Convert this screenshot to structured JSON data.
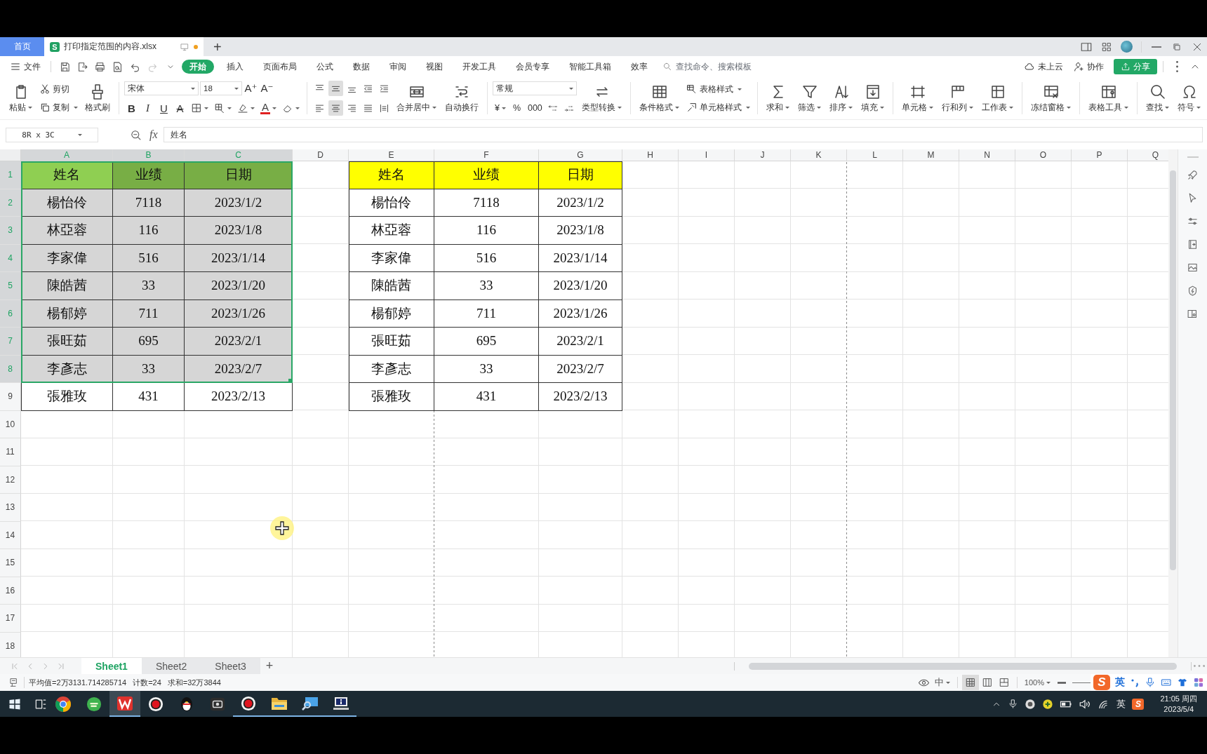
{
  "tab_bar": {
    "home_tab": "首页",
    "document_tab": {
      "app_badge": "S",
      "title": "打印指定范围的内容.xlsx",
      "unsaved": true
    },
    "new_tab": "+"
  },
  "menu_bar": {
    "file": "文件",
    "tabs": [
      {
        "label": "开始",
        "selected": true
      },
      {
        "label": "插入",
        "selected": false
      },
      {
        "label": "页面布局",
        "selected": false
      },
      {
        "label": "公式",
        "selected": false
      },
      {
        "label": "数据",
        "selected": false
      },
      {
        "label": "审阅",
        "selected": false
      },
      {
        "label": "视图",
        "selected": false
      },
      {
        "label": "开发工具",
        "selected": false
      },
      {
        "label": "会员专享",
        "selected": false
      },
      {
        "label": "智能工具箱",
        "selected": false
      },
      {
        "label": "效率",
        "selected": false
      }
    ],
    "search": {
      "placeholder": "查找命令、搜索模板"
    },
    "cloud_status": "未上云",
    "collaborate": "协作",
    "share": "分享"
  },
  "ribbon": {
    "paste": {
      "label": "粘贴",
      "dropdown": true
    },
    "cut": {
      "label": "剪切",
      "dropdown": false
    },
    "copy": {
      "label": "复制",
      "dropdown": true
    },
    "format_painter": {
      "label": "格式刷",
      "dropdown": false
    },
    "font_name": "宋体",
    "font_size": "18",
    "size_buttons": [
      "A⁺",
      "A⁻"
    ],
    "style_glyphs": [
      "B",
      "I",
      "U",
      "A"
    ],
    "font_color_glyph": "A",
    "vertical_align": [
      {
        "selected": false
      },
      {
        "selected": true
      },
      {
        "selected": false
      }
    ],
    "horizontal_align": [
      {
        "selected": false
      },
      {
        "selected": true
      },
      {
        "selected": false
      },
      {
        "selected": false
      }
    ],
    "merge": {
      "label": "合并居中",
      "dropdown": true
    },
    "wrap": {
      "label": "自动换行",
      "dropdown": false
    },
    "number_format": "常规",
    "number_glyphs": [
      {
        "glyph": "¥",
        "dropdown": true
      },
      {
        "glyph": "%",
        "dropdown": false
      },
      {
        "glyph": "000",
        "dropdown": false
      }
    ],
    "command_groups": [
      {
        "buttons": [
          {
            "label": "类型转换",
            "dropdown": true,
            "kind": "large"
          }
        ]
      },
      {
        "buttons": [
          {
            "label": "条件格式",
            "dropdown": true,
            "kind": "large"
          },
          {
            "label": "表格样式",
            "dropdown": true,
            "kind": "small"
          },
          {
            "label": "单元格样式",
            "dropdown": true,
            "kind": "small"
          }
        ]
      },
      {
        "buttons": [
          {
            "label": "求和",
            "dropdown": true,
            "kind": "large"
          },
          {
            "label": "筛选",
            "dropdown": true,
            "kind": "large"
          },
          {
            "label": "排序",
            "dropdown": true,
            "kind": "large"
          },
          {
            "label": "填充",
            "dropdown": true,
            "kind": "large"
          }
        ]
      },
      {
        "buttons": [
          {
            "label": "单元格",
            "dropdown": true,
            "kind": "large"
          },
          {
            "label": "行和列",
            "dropdown": true,
            "kind": "large"
          },
          {
            "label": "工作表",
            "dropdown": true,
            "kind": "large"
          }
        ]
      },
      {
        "buttons": [
          {
            "label": "冻结窗格",
            "dropdown": true,
            "kind": "large"
          }
        ]
      },
      {
        "buttons": [
          {
            "label": "表格工具",
            "dropdown": true,
            "kind": "large"
          }
        ]
      },
      {
        "buttons": [
          {
            "label": "查找",
            "dropdown": true,
            "kind": "large"
          },
          {
            "label": "符号",
            "dropdown": true,
            "kind": "large"
          }
        ]
      }
    ]
  },
  "formula_bar": {
    "name_box": "8R x 3C",
    "fx": "fx",
    "content": "姓名"
  },
  "sheet": {
    "columns": [
      {
        "label": "A",
        "selected": true
      },
      {
        "label": "B",
        "selected": true
      },
      {
        "label": "C",
        "selected": true
      },
      {
        "label": "D",
        "selected": false
      },
      {
        "label": "E",
        "selected": false
      },
      {
        "label": "F",
        "selected": false
      },
      {
        "label": "G",
        "selected": false
      },
      {
        "label": "H",
        "selected": false
      },
      {
        "label": "I",
        "selected": false
      },
      {
        "label": "J",
        "selected": false
      },
      {
        "label": "K",
        "selected": false
      },
      {
        "label": "L",
        "selected": false
      },
      {
        "label": "M",
        "selected": false
      },
      {
        "label": "N",
        "selected": false
      },
      {
        "label": "O",
        "selected": false
      },
      {
        "label": "P",
        "selected": false
      },
      {
        "label": "Q",
        "selected": false
      }
    ],
    "rows": [
      {
        "label": "1",
        "selected": true,
        "kind": "header",
        "cells": [
          {
            "text": "姓名",
            "active": true
          },
          {
            "text": "业绩",
            "active": false
          },
          {
            "text": "日期",
            "active": false
          }
        ],
        "copy": [
          "姓名",
          "业绩",
          "日期"
        ]
      },
      {
        "label": "2",
        "selected": true,
        "kind": "data",
        "cells": [
          {
            "text": "楊怡伶",
            "active": false
          },
          {
            "text": "7118",
            "active": false
          },
          {
            "text": "2023/1/2",
            "active": false
          }
        ],
        "copy": [
          "楊怡伶",
          "7118",
          "2023/1/2"
        ]
      },
      {
        "label": "3",
        "selected": true,
        "kind": "data",
        "cells": [
          {
            "text": "林亞蓉",
            "active": false
          },
          {
            "text": "116",
            "active": false
          },
          {
            "text": "2023/1/8",
            "active": false
          }
        ],
        "copy": [
          "林亞蓉",
          "116",
          "2023/1/8"
        ]
      },
      {
        "label": "4",
        "selected": true,
        "kind": "data",
        "cells": [
          {
            "text": "李家偉",
            "active": false
          },
          {
            "text": "516",
            "active": false
          },
          {
            "text": "2023/1/14",
            "active": false
          }
        ],
        "copy": [
          "李家偉",
          "516",
          "2023/1/14"
        ]
      },
      {
        "label": "5",
        "selected": true,
        "kind": "data",
        "cells": [
          {
            "text": "陳皓茜",
            "active": false
          },
          {
            "text": "33",
            "active": false
          },
          {
            "text": "2023/1/20",
            "active": false
          }
        ],
        "copy": [
          "陳皓茜",
          "33",
          "2023/1/20"
        ]
      },
      {
        "label": "6",
        "selected": true,
        "kind": "data",
        "cells": [
          {
            "text": "楊郁婷",
            "active": false
          },
          {
            "text": "711",
            "active": false
          },
          {
            "text": "2023/1/26",
            "active": false
          }
        ],
        "copy": [
          "楊郁婷",
          "711",
          "2023/1/26"
        ]
      },
      {
        "label": "7",
        "selected": true,
        "kind": "data",
        "cells": [
          {
            "text": "張旺茹",
            "active": false
          },
          {
            "text": "695",
            "active": false
          },
          {
            "text": "2023/2/1",
            "active": false
          }
        ],
        "copy": [
          "張旺茹",
          "695",
          "2023/2/1"
        ]
      },
      {
        "label": "8",
        "selected": true,
        "kind": "data",
        "cells": [
          {
            "text": "李彥志",
            "active": false
          },
          {
            "text": "33",
            "active": false
          },
          {
            "text": "2023/2/7",
            "active": false
          }
        ],
        "copy": [
          "李彥志",
          "33",
          "2023/2/7"
        ]
      },
      {
        "label": "9",
        "selected": false,
        "kind": "data",
        "cells": [
          {
            "text": "張雅玫"
          },
          {
            "text": "431"
          },
          {
            "text": "2023/2/13"
          }
        ],
        "copy": [
          "張雅玫",
          "431",
          "2023/2/13"
        ]
      },
      {
        "label": "10",
        "selected": false
      },
      {
        "label": "11",
        "selected": false
      },
      {
        "label": "12",
        "selected": false
      },
      {
        "label": "13",
        "selected": false
      },
      {
        "label": "14",
        "selected": false
      },
      {
        "label": "15",
        "selected": false
      },
      {
        "label": "16",
        "selected": false
      },
      {
        "label": "17",
        "selected": false
      },
      {
        "label": "18",
        "selected": false
      }
    ]
  },
  "sheet_tabs": {
    "tabs": [
      {
        "label": "Sheet1",
        "selected": true
      },
      {
        "label": "Sheet2",
        "selected": false
      },
      {
        "label": "Sheet3",
        "selected": false
      }
    ],
    "add": "+"
  },
  "status_bar": {
    "stats": [
      "平均值=2万3131.714285714",
      "计数=24",
      "求和=32万3844"
    ],
    "input_mode": "中",
    "views": [
      {
        "selected": true
      },
      {
        "selected": false
      },
      {
        "selected": false
      }
    ],
    "zoom": "100%"
  },
  "ime_toolbar": {
    "logo": "S",
    "language": "英"
  },
  "taskbar": {
    "apps": [
      {
        "running": false,
        "selected": false
      },
      {
        "running": false,
        "selected": false
      },
      {
        "running": true,
        "selected": true
      },
      {
        "running": false,
        "selected": false
      },
      {
        "running": false,
        "selected": false
      },
      {
        "running": false,
        "selected": false
      },
      {
        "running": true,
        "selected": false
      },
      {
        "running": true,
        "selected": false
      },
      {
        "running": true,
        "selected": false
      },
      {
        "running": true,
        "selected": false
      }
    ],
    "tray": {
      "language": "英",
      "ime_logo": "S",
      "time": "21:05 周四",
      "date": "2023/5/4"
    }
  }
}
